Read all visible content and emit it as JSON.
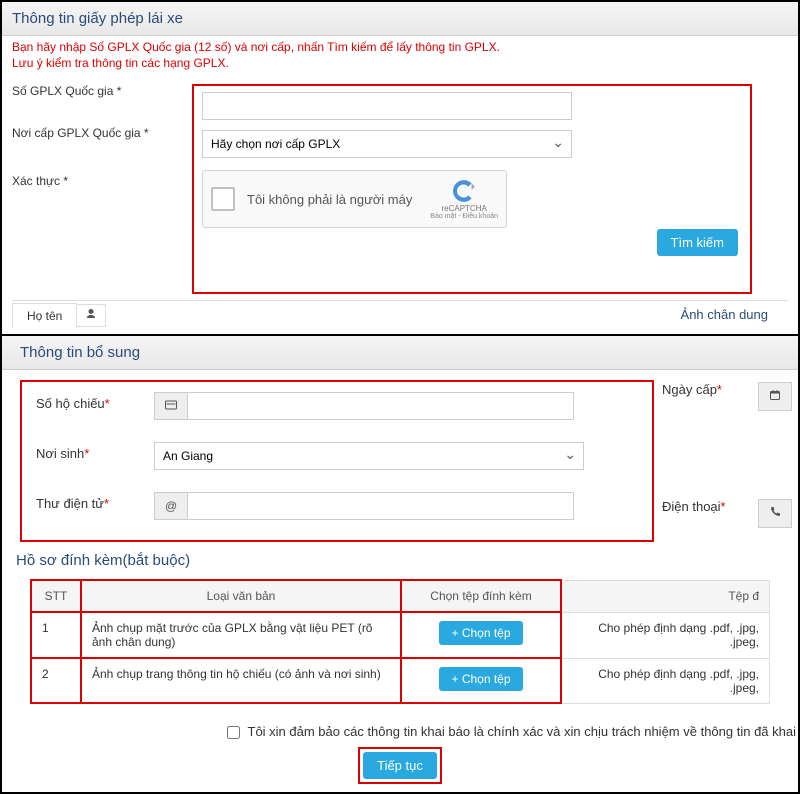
{
  "top": {
    "title": "Thông tin giấy phép lái xe",
    "hint1": "Bạn hãy nhập Số GPLX Quốc gia (12 số) và nơi cấp, nhấn Tìm kiếm để lấy thông tin GPLX.",
    "hint2": "Lưu ý kiểm tra thông tin các hạng GPLX.",
    "fields": {
      "so_gplx": "Số GPLX Quốc gia *",
      "noi_cap": "Nơi cấp GPLX Quốc gia *",
      "xac_thuc": "Xác thực *"
    },
    "placeholders": {
      "noi_cap": "Hãy chọn nơi cấp GPLX"
    },
    "recaptcha": {
      "text": "Tôi không phải là người máy",
      "brand": "reCAPTCHA",
      "links": "Bảo mật - Điều khoản"
    },
    "search_btn": "Tìm kiếm",
    "tab_hoten": "Họ tên",
    "tab_right": "Ảnh chân dung"
  },
  "mid": {
    "title": "Thông tin bổ sung",
    "labels": {
      "passport": "Số hộ chiếu",
      "dob_place": "Nơi sinh",
      "email": "Thư điện tử",
      "issue_date": "Ngày cấp",
      "phone": "Điện thoại"
    },
    "noisinh_value": "An Giang",
    "addon": {
      "passport": "▭",
      "email": "@",
      "date": "📅",
      "phone": "☎"
    }
  },
  "attach": {
    "title": "Hồ sơ đính kèm(bắt buộc)",
    "headers": {
      "stt": "STT",
      "type": "Loại văn bản",
      "choose": "Chọn tệp đính kèm",
      "filename": "Tệp đ"
    },
    "rows": [
      {
        "idx": "1",
        "type": "Ảnh chụp mặt trước của GPLX bằng vật liệu PET (rõ ảnh chân dung)",
        "hint": "Cho phép định dạng .pdf, .jpg, .jpeg,"
      },
      {
        "idx": "2",
        "type": "Ảnh chụp trang thông tin hộ chiếu (có ảnh và nơi sinh)",
        "hint": "Cho phép định dạng .pdf, .jpg, .jpeg,"
      }
    ],
    "choose_btn": "Chọn tệp"
  },
  "confirm": {
    "text": "Tôi xin đảm bảo các thông tin khai báo là chính xác và xin chịu trách nhiệm về thông tin đã khai",
    "continue": "Tiếp tục"
  }
}
